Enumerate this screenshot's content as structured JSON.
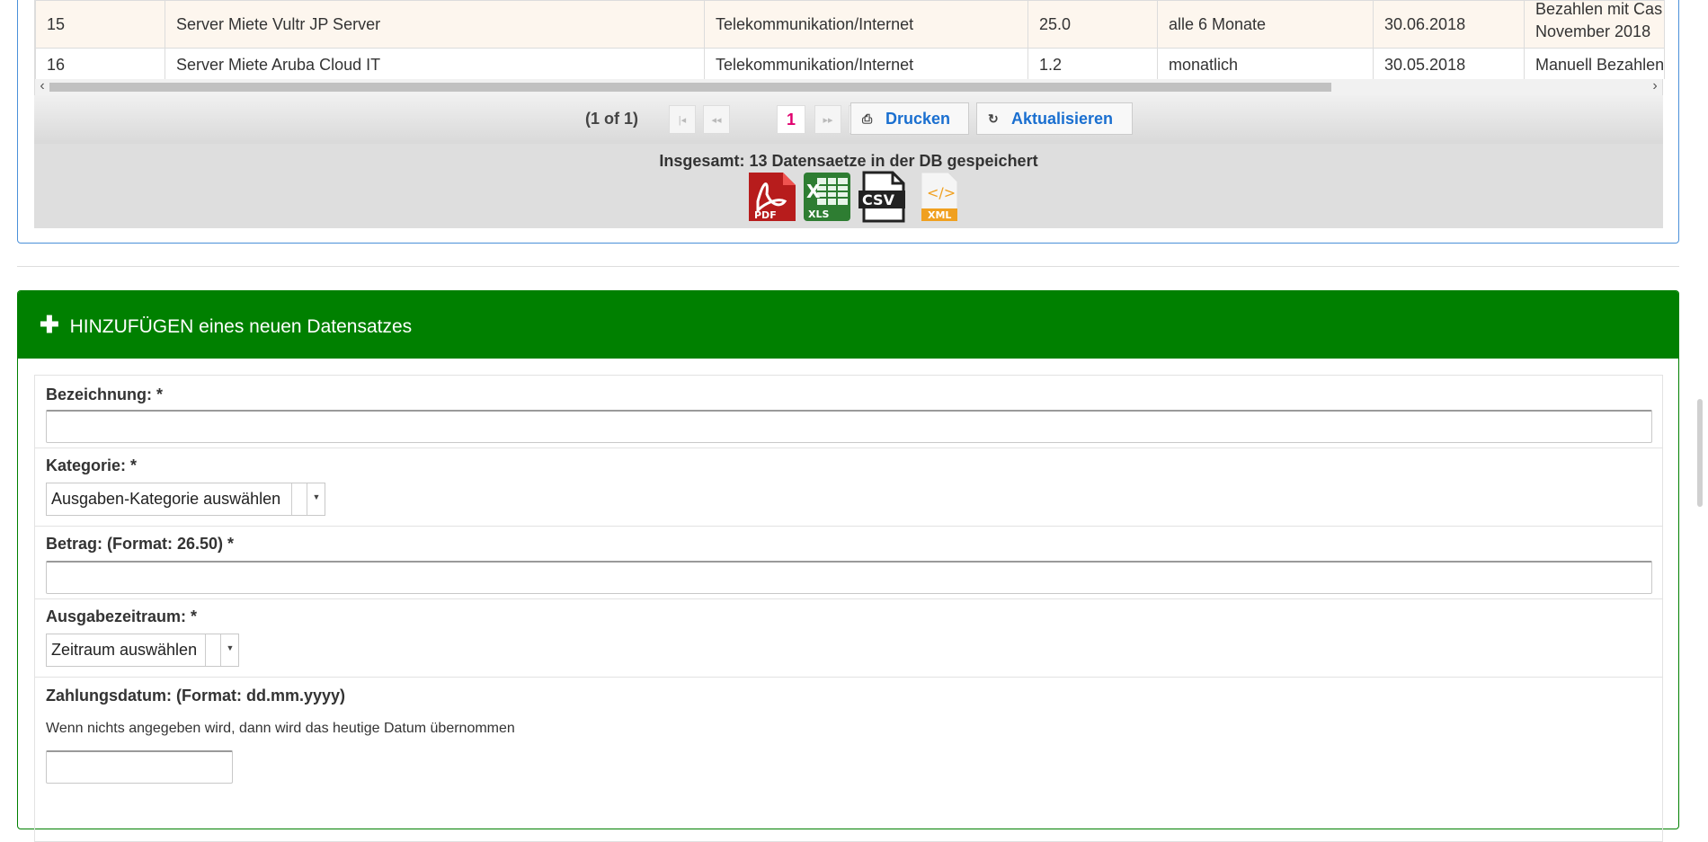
{
  "table": {
    "rows": [
      {
        "nr": "15",
        "bezeichnung": "Server Miete Vultr JP Server",
        "kategorie": "Telekommunikation/Internet",
        "betrag": "25.0",
        "zeitraum": "alle 6 Monate",
        "datum": "30.06.2018",
        "zahlung_1": "Bezahlen mit Cas",
        "zahlung_2": "November 2018"
      },
      {
        "nr": "16",
        "bezeichnung": "Server Miete Aruba Cloud IT",
        "kategorie": "Telekommunikation/Internet",
        "betrag": "1.2",
        "zeitraum": "monatlich",
        "datum": "30.05.2018",
        "zahlung_1": "Manuell Bezahlen",
        "zahlung_2": ""
      }
    ]
  },
  "scrollbar": {
    "left_arrow": "‹",
    "right_arrow": "›"
  },
  "paginator": {
    "count": "(1 of 1)",
    "first": "|◂",
    "prev": "◂◂",
    "page": "1",
    "next": "▸▸",
    "last": "▸|",
    "print_label": "Drucken",
    "print_icon": "⎙",
    "refresh_label": "Aktualisieren",
    "refresh_icon": "↻"
  },
  "footer": {
    "total": "Insgesamt: 13 Datensaetze in der DB gespeichert",
    "exports": {
      "pdf": "PDF",
      "xls": "XLS",
      "csv": "CSV",
      "xml": "XML"
    }
  },
  "add_form": {
    "header_icon": "✚",
    "header": "HINZUFÜGEN eines neuen Datensatzes",
    "bezeichnung_label": "Bezeichnung:  *",
    "kategorie_label": "Kategorie:  *",
    "kategorie_value": "Ausgaben-Kategorie auswählen",
    "betrag_label": "Betrag: (Format: 26.50)  *",
    "zeitraum_label": "Ausgabezeitraum:  *",
    "zeitraum_value": "Zeitraum auswählen",
    "datum_label": "Zahlungsdatum: (Format: dd.mm.yyyy)",
    "datum_hint": "Wenn nichts angegeben wird, dann wird das heutige Datum übernommen",
    "select_arrow": "▼"
  },
  "colors": {
    "panel_blue": "#4a90d9",
    "header_green": "#008000",
    "active_page": "#e0006e",
    "link_blue": "#1a6fd0"
  }
}
